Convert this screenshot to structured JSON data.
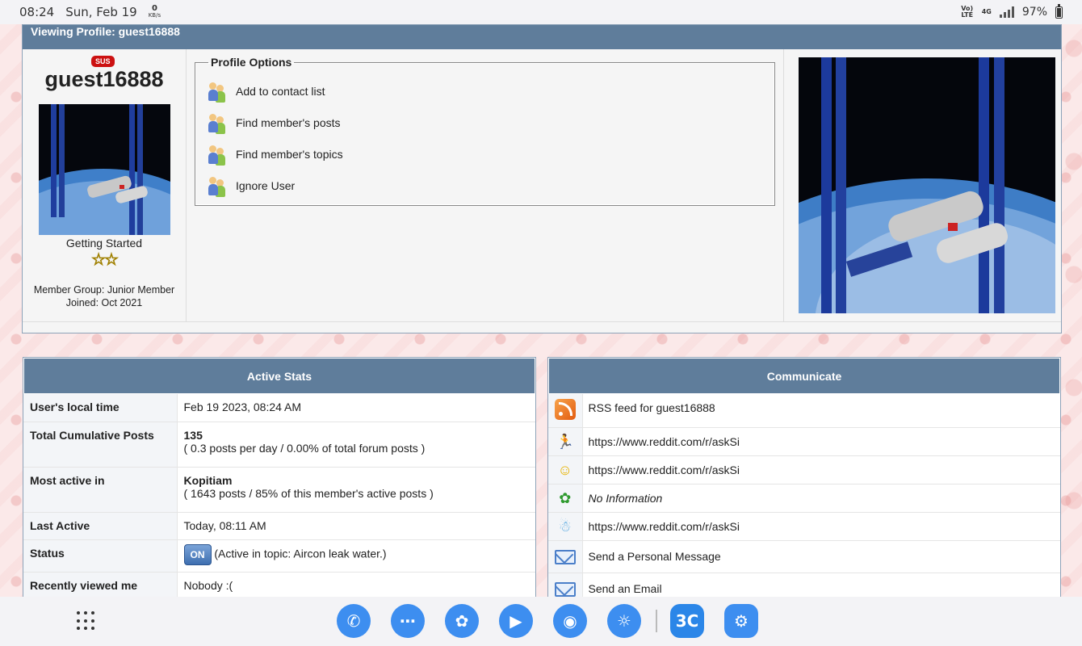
{
  "statusbar": {
    "time": "08:24",
    "date": "Sun, Feb 19",
    "net_speed": "0",
    "net_unit": "KB/s",
    "volte": "Vo) LTE",
    "network": "4G",
    "battery": "97%"
  },
  "profile": {
    "header": "Viewing Profile: guest16888",
    "badge": "SUS",
    "username": "guest16888",
    "rank": "Getting Started",
    "stars": "☆☆",
    "member_group": "Member Group: Junior Member",
    "joined": "Joined: Oct 2021",
    "options_title": "Profile Options",
    "options": [
      {
        "label": "Add to contact list",
        "icon": "people-icon"
      },
      {
        "label": "Find member's posts",
        "icon": "people-icon"
      },
      {
        "label": "Find member's topics",
        "icon": "people-icon"
      },
      {
        "label": "Ignore User",
        "icon": "people-icon"
      }
    ]
  },
  "active_stats": {
    "title": "Active Stats",
    "rows": [
      {
        "label": "User's local time",
        "value": "Feb 19 2023, 08:24 AM"
      },
      {
        "label": "Total Cumulative Posts",
        "value_bold": "135",
        "value": "( 0.3 posts per day / 0.00% of total forum posts )"
      },
      {
        "label": "Most active in",
        "value_bold": "Kopitiam",
        "value": "( 1643 posts / 85% of this member's active posts )"
      },
      {
        "label": "Last Active",
        "value": "Today, 08:11 AM"
      },
      {
        "label": "Status",
        "badge": "ON",
        "value": "(Active in topic: Aircon leak water.)"
      },
      {
        "label": "Recently viewed me",
        "value": "Nobody :("
      }
    ]
  },
  "communicate": {
    "title": "Communicate",
    "rows": [
      {
        "icon": "rss-icon",
        "value": "RSS feed for guest16888"
      },
      {
        "icon": "aim-icon",
        "value": "https://www.reddit.com/r/askSi"
      },
      {
        "icon": "yahoo-icon",
        "value": "https://www.reddit.com/r/askSi"
      },
      {
        "icon": "icq-icon",
        "value": "No Information"
      },
      {
        "icon": "msn-icon",
        "value": "https://www.reddit.com/r/askSi"
      },
      {
        "icon": "pm-mail-icon",
        "value": "Send a Personal Message"
      },
      {
        "icon": "email-icon",
        "value": "Send an Email"
      }
    ]
  },
  "dock": {
    "apps": [
      "phone-icon",
      "messages-icon",
      "bixby-icon",
      "play-store-icon",
      "camera-icon",
      "internet-icon",
      "lowyat-app-icon",
      "settings-icon"
    ],
    "lowyat_label": "3C"
  }
}
